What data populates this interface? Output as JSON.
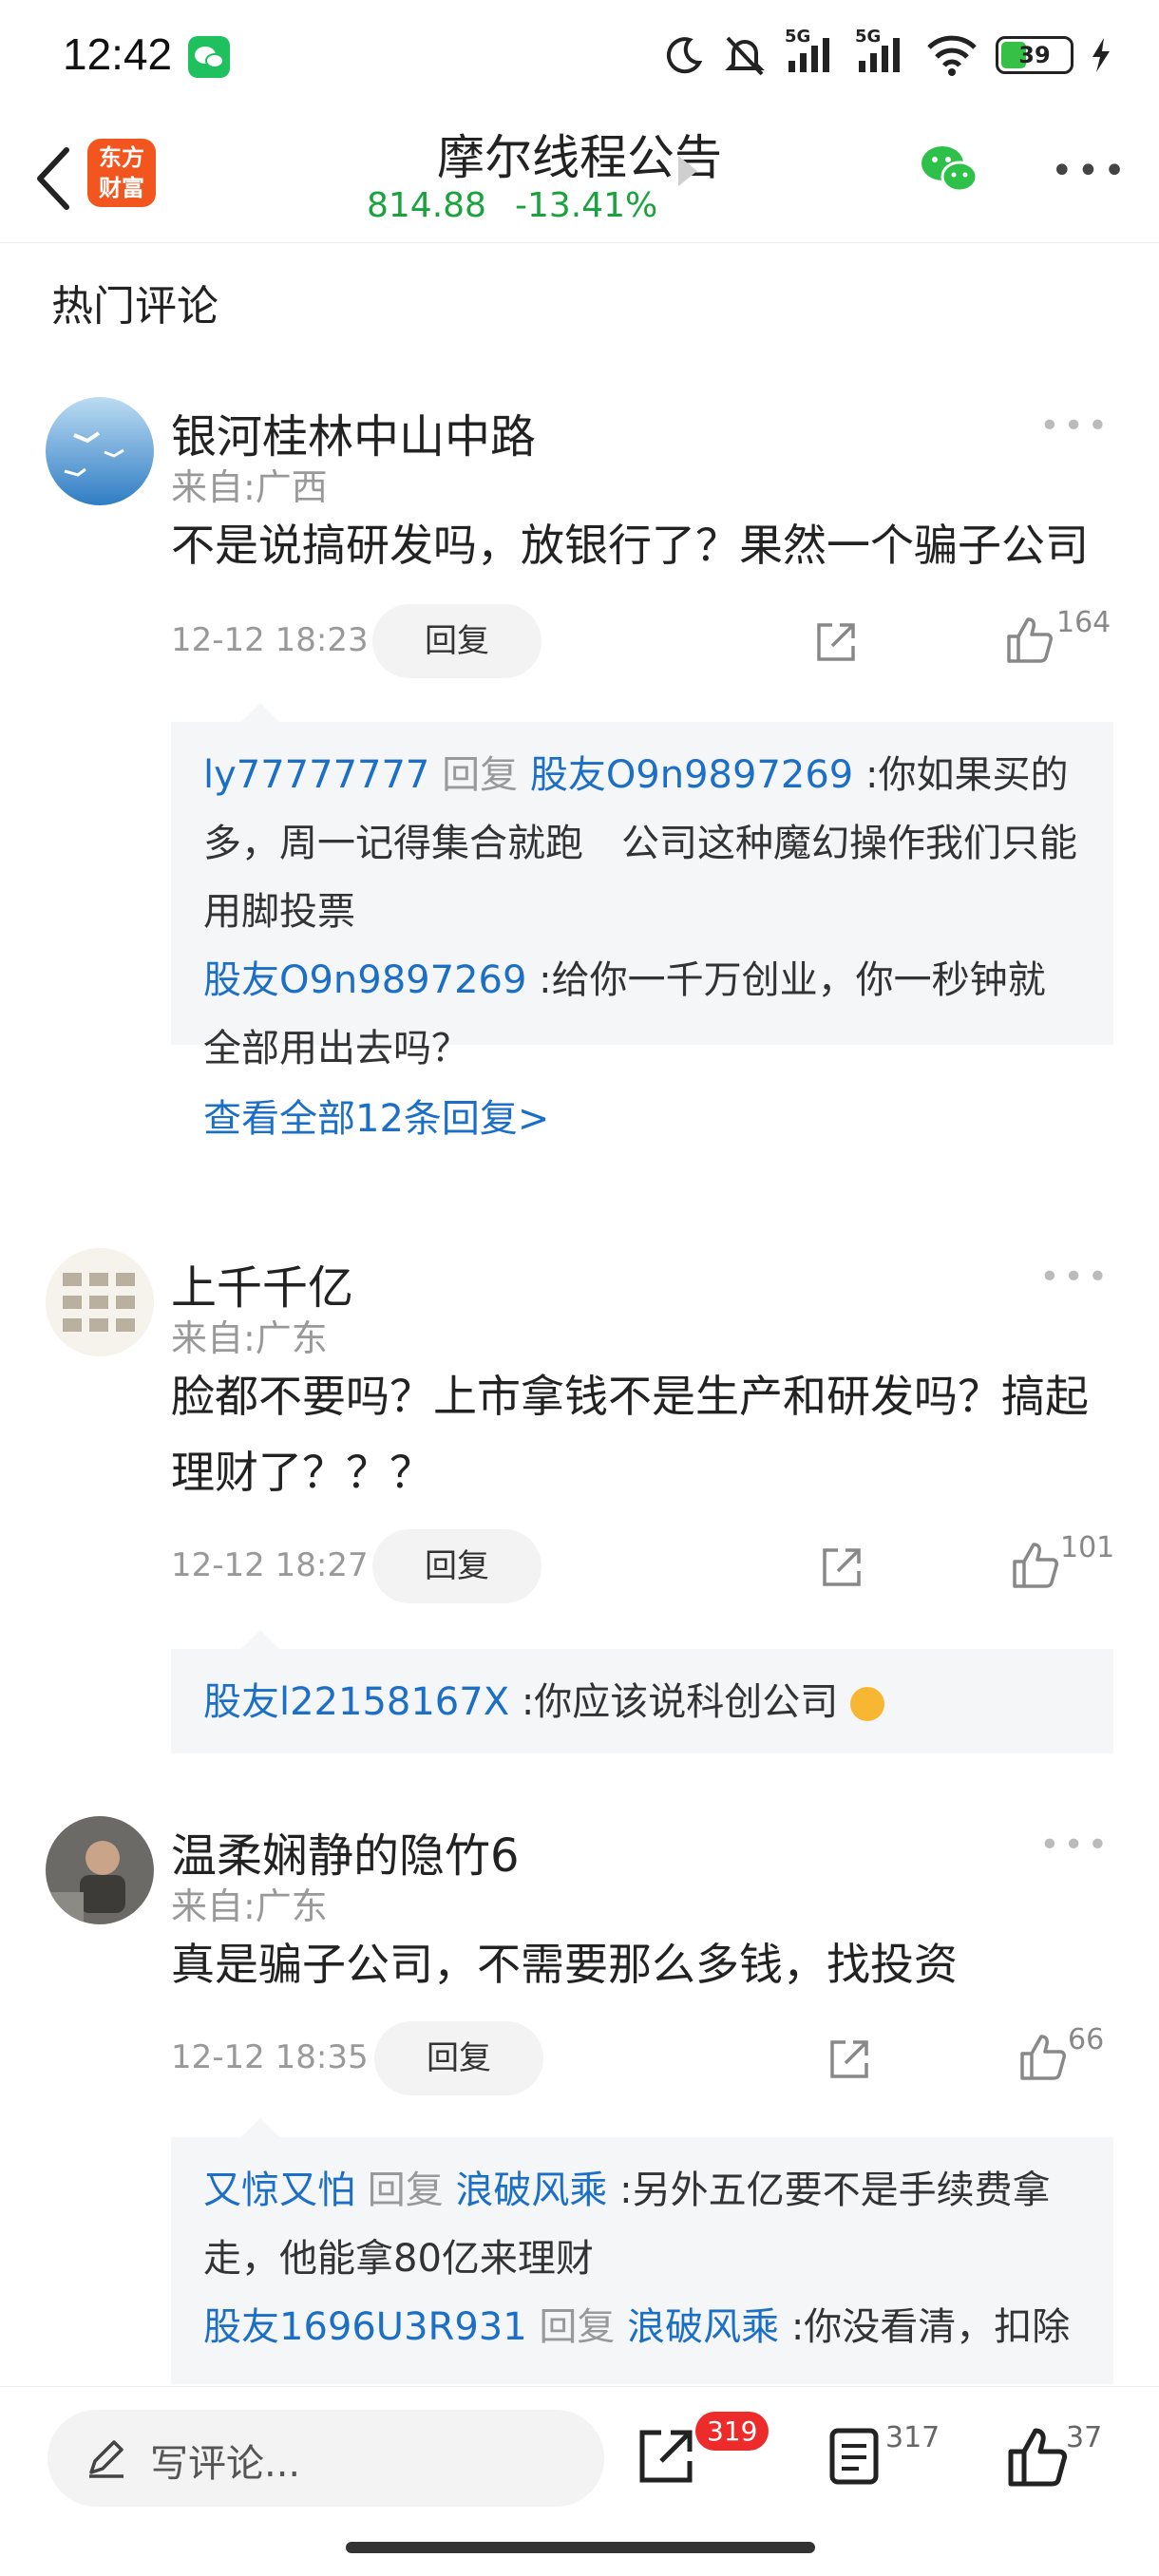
{
  "status_bar": {
    "time": "12:42",
    "network_1": "5G",
    "network_2": "5G",
    "battery": "39"
  },
  "header": {
    "logo_text_line1": "东方",
    "logo_text_line2": "财富",
    "title": "摩尔线程公告",
    "price": "814.88",
    "change": "-13.41%",
    "accent_color": "#1aa33d"
  },
  "section_title": "热门评论",
  "comments": [
    {
      "name": "银河桂林中山中路",
      "location": "来自:广西",
      "text": "不是说搞研发吗，放银行了？果然一个骗子公司",
      "time": "12-12 18:23",
      "reply_label": "回复",
      "likes": "164",
      "replies": [
        {
          "user": "ly77777777",
          "tag": "回复",
          "target": "股友O9n9897269",
          "text": ":你如果买的多，周一记得集合就跑　公司这种魔幻操作我们只能用脚投票"
        },
        {
          "user": "股友O9n9897269",
          "text": ":给你一千万创业，你一秒钟就全部用出去吗？"
        }
      ],
      "view_all": "查看全部12条回复>"
    },
    {
      "name": "上千千亿",
      "location": "来自:广东",
      "text": "脸都不要吗？上市拿钱不是生产和研发吗？搞起理财了？？？",
      "time": "12-12 18:27",
      "reply_label": "回复",
      "likes": "101",
      "replies": [
        {
          "user": "股友l22158167X",
          "text": ":你应该说科创公司"
        }
      ]
    },
    {
      "name": "温柔娴静的隐竹6",
      "location": "来自:广东",
      "text": "真是骗子公司，不需要那么多钱，找投资",
      "time": "12-12 18:35",
      "reply_label": "回复",
      "likes": "66",
      "replies": [
        {
          "user": "又惊又怕",
          "tag": "回复",
          "target": "浪破风乘",
          "text": ":另外五亿要不是手续费拿走，他能拿80亿来理财"
        },
        {
          "user": "股友1696U3R931",
          "tag": "回复",
          "target": "浪破风乘",
          "text": ":你没看清，扣除"
        }
      ]
    }
  ],
  "bottom_bar": {
    "input_placeholder": "写评论...",
    "share_badge": "319",
    "comments_count": "317",
    "likes_count": "37"
  }
}
